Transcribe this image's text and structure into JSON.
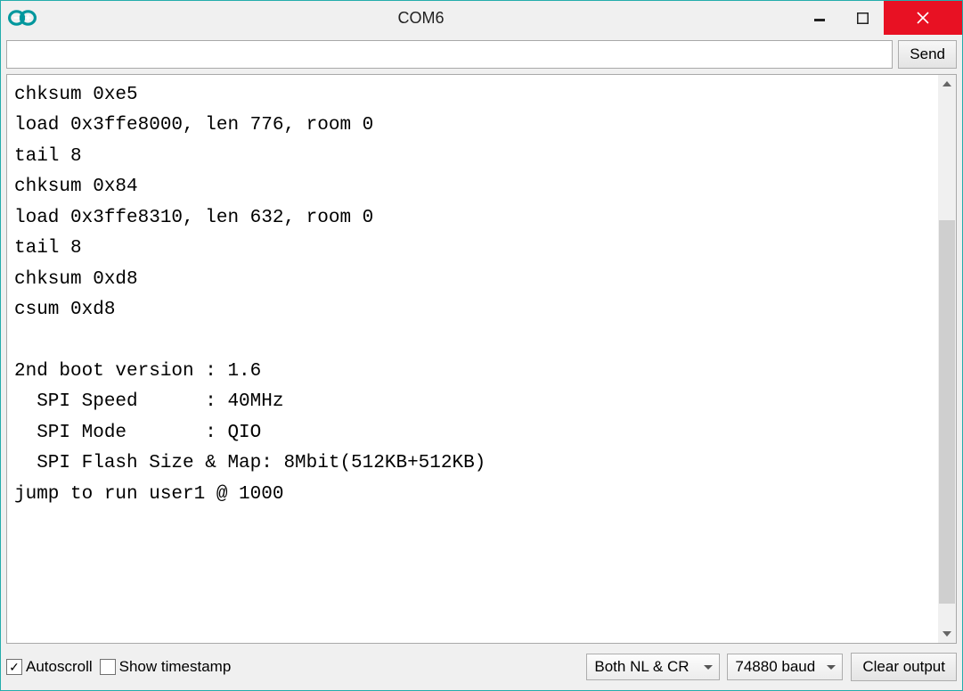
{
  "window": {
    "title": "COM6"
  },
  "toolbar": {
    "input_value": "",
    "send_label": "Send"
  },
  "output_text": "chksum 0xe5\nload 0x3ffe8000, len 776, room 0 \ntail 8\nchksum 0x84\nload 0x3ffe8310, len 632, room 0 \ntail 8\nchksum 0xd8\ncsum 0xd8\n\n2nd boot version : 1.6\n  SPI Speed      : 40MHz\n  SPI Mode       : QIO\n  SPI Flash Size & Map: 8Mbit(512KB+512KB)\njump to run user1 @ 1000\n",
  "status": {
    "autoscroll_label": "Autoscroll",
    "autoscroll_checked": true,
    "timestamp_label": "Show timestamp",
    "timestamp_checked": false,
    "line_ending_selected": "Both NL & CR",
    "baud_selected": "74880 baud",
    "clear_label": "Clear output"
  },
  "icons": {
    "app": "arduino-logo-icon",
    "minimize": "minimize-icon",
    "maximize": "maximize-icon",
    "close": "close-icon",
    "scroll_up": "chevron-up-icon",
    "scroll_down": "chevron-down-icon",
    "dropdown": "chevron-down-icon"
  }
}
